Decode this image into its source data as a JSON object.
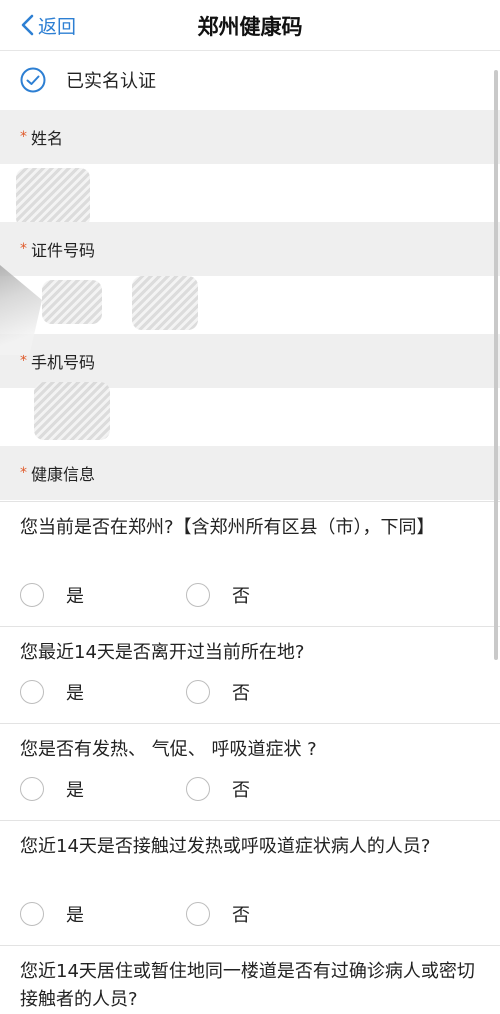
{
  "header": {
    "back_label": "返回",
    "title": "郑州健康码"
  },
  "verification": {
    "label": "已实名认证",
    "icon": "check-circle-icon"
  },
  "fields": [
    {
      "label": "姓名",
      "required_mark": "*"
    },
    {
      "label": "证件号码",
      "required_mark": "*"
    },
    {
      "label": "手机号码",
      "required_mark": "*"
    },
    {
      "label": "健康信息",
      "required_mark": "*"
    }
  ],
  "questions": [
    {
      "text": "您当前是否在郑州?【含郑州所有区县（市），下同】",
      "yes": "是",
      "no": "否"
    },
    {
      "text": "您最近14天是否离开过当前所在地?",
      "yes": "是",
      "no": "否"
    },
    {
      "text": "您是否有发热、 气促、 呼吸道症状 ?",
      "yes": "是",
      "no": "否"
    },
    {
      "text": "您近14天是否接触过发热或呼吸道症状病人的人员?",
      "yes": "是",
      "no": "否"
    },
    {
      "text": "您近14天居住或暂住地同一楼道是否有过确诊病人或密切接触者的人员?"
    }
  ],
  "colors": {
    "accent": "#2d7fd3",
    "required": "#e05a2a",
    "section_bg": "#efefef"
  }
}
